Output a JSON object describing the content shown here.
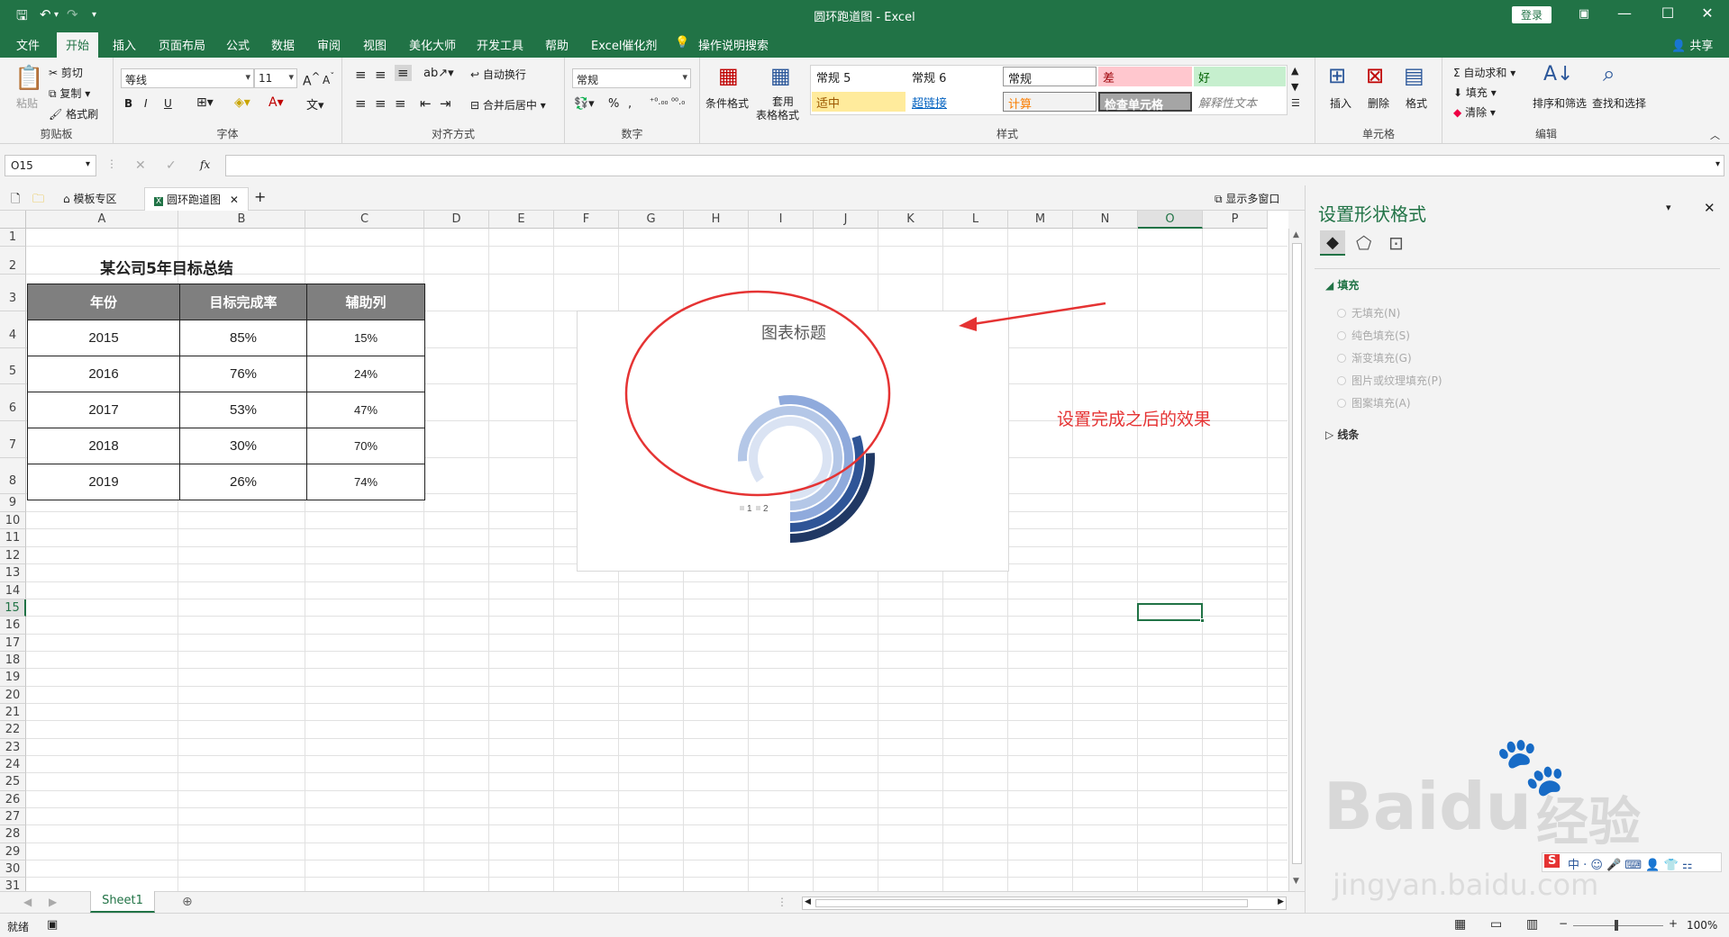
{
  "window": {
    "title": "圆环跑道图 - Excel",
    "login_label": "登录",
    "share_label": "共享"
  },
  "menu": {
    "tabs": [
      "文件",
      "开始",
      "插入",
      "页面布局",
      "公式",
      "数据",
      "审阅",
      "视图",
      "美化大师",
      "开发工具",
      "帮助",
      "Excel催化剂"
    ],
    "active_index": 1,
    "search": "操作说明搜索"
  },
  "ribbon": {
    "clipboard": {
      "paste": "粘贴",
      "cut": "剪切",
      "copy": "复制",
      "format_painter": "格式刷",
      "label": "剪贴板"
    },
    "font": {
      "name": "等线",
      "size": "11",
      "bold": "B",
      "italic": "I",
      "underline": "U",
      "label": "字体"
    },
    "alignment": {
      "wrap": "自动换行",
      "merge": "合并后居中",
      "label": "对齐方式"
    },
    "number": {
      "format": "常规",
      "percent": "%",
      "comma": ",",
      "label": "数字"
    },
    "styles": {
      "conditional": "条件格式",
      "table_a": "套用",
      "table_b": "表格格式",
      "cells": [
        "常规 5",
        "常规 6",
        "常规",
        "差",
        "好",
        "适中",
        "超链接",
        "计算",
        "检查单元格",
        "解释性文本"
      ],
      "label": "样式"
    },
    "cells": {
      "insert": "插入",
      "delete": "删除",
      "format": "格式",
      "label": "单元格"
    },
    "editing": {
      "autosum": "自动求和",
      "fill": "填充",
      "clear": "清除",
      "sort": "排序和筛选",
      "find": "查找和选择",
      "label": "编辑"
    }
  },
  "formula_bar": {
    "name_box": "O15",
    "fx": "fx",
    "value": ""
  },
  "doc_tabs": {
    "tab1": "模板专区",
    "tab2": "圆环跑道图",
    "multi_window": "显示多窗口"
  },
  "columns": [
    "A",
    "B",
    "C",
    "D",
    "E",
    "F",
    "G",
    "H",
    "I",
    "J",
    "K",
    "L",
    "M",
    "N",
    "O",
    "P"
  ],
  "rows": [
    "1",
    "2",
    "3",
    "4",
    "5",
    "6",
    "7",
    "8",
    "9",
    "10",
    "11",
    "12",
    "13",
    "14",
    "15",
    "16",
    "17",
    "18",
    "19",
    "20",
    "21",
    "22",
    "23",
    "24",
    "25",
    "26",
    "27",
    "28",
    "29",
    "30",
    "31"
  ],
  "sheet": {
    "title": "某公司5年目标总结",
    "headers": [
      "年份",
      "目标完成率",
      "辅助列"
    ],
    "rows": [
      [
        "2015",
        "85%",
        "15%"
      ],
      [
        "2016",
        "76%",
        "24%"
      ],
      [
        "2017",
        "53%",
        "47%"
      ],
      [
        "2018",
        "30%",
        "70%"
      ],
      [
        "2019",
        "26%",
        "74%"
      ]
    ]
  },
  "chart_data": {
    "type": "doughnut",
    "title": "图表标题",
    "categories": [
      "2015",
      "2016",
      "2017",
      "2018",
      "2019"
    ],
    "series": [
      {
        "name": "1",
        "values": [
          0.85,
          0.76,
          0.53,
          0.3,
          0.26
        ]
      },
      {
        "name": "2",
        "values": [
          0.15,
          0.24,
          0.47,
          0.7,
          0.74
        ]
      }
    ],
    "legend": [
      "1",
      "2"
    ],
    "ring_colors": [
      "#203864",
      "#2f5597",
      "#8faadc",
      "#b4c7e7",
      "#dae3f3"
    ]
  },
  "annotation": "设置完成之后的效果",
  "sheet_tabs": {
    "active": "Sheet1"
  },
  "status": {
    "ready": "就绪",
    "zoom": "100%"
  },
  "pane": {
    "title": "设置形状格式",
    "fill_section": "填充",
    "options": [
      "无填充(N)",
      "纯色填充(S)",
      "渐变填充(G)",
      "图片或纹理填充(P)",
      "图案填充(A)"
    ],
    "line_section": "线条"
  },
  "watermark": {
    "brand": "Baidu",
    "brand2": "经验",
    "url": "jingyan.baidu.com"
  },
  "colors": {
    "excel_green": "#217346",
    "annotation_red": "#e53333",
    "header_gray": "#7f7f7f"
  }
}
